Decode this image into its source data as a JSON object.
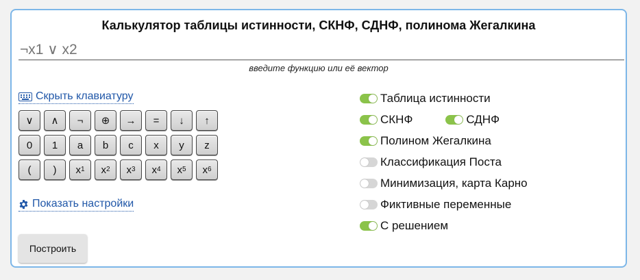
{
  "title": "Калькулятор таблицы истинности, СКНФ, СДНФ, полинома Жегалкина",
  "function_input": {
    "value": "",
    "placeholder": "¬x1 ∨ x2"
  },
  "hint": "введите функцию или её вектор",
  "keyboard_toggle": {
    "label": "Скрыть клавиатуру",
    "icon": "keyboard-icon"
  },
  "settings_toggle": {
    "label": "Показать настройки",
    "icon": "gear-icon"
  },
  "keyboard": {
    "row1": [
      "∨",
      "∧",
      "¬",
      "⊕",
      "→",
      "=",
      "↓",
      "↑"
    ],
    "row2": [
      "0",
      "1",
      "a",
      "b",
      "c",
      "x",
      "y",
      "z"
    ],
    "row3": [
      "(",
      ")"
    ],
    "vars": [
      {
        "base": "x",
        "sub": "1"
      },
      {
        "base": "x",
        "sub": "2"
      },
      {
        "base": "x",
        "sub": "3"
      },
      {
        "base": "x",
        "sub": "4"
      },
      {
        "base": "x",
        "sub": "5"
      },
      {
        "base": "x",
        "sub": "6"
      }
    ]
  },
  "build_button": "Построить",
  "options": {
    "truth_table": {
      "label": "Таблица истинности",
      "on": true
    },
    "cnf": {
      "label": "СКНФ",
      "on": true
    },
    "dnf": {
      "label": "СДНФ",
      "on": true
    },
    "zhegalkin": {
      "label": "Полином Жегалкина",
      "on": true
    },
    "post": {
      "label": "Классификация Поста",
      "on": false
    },
    "karnaugh": {
      "label": "Минимизация, карта Карно",
      "on": false
    },
    "fictitious": {
      "label": "Фиктивные переменные",
      "on": false
    },
    "solution": {
      "label": "С решением",
      "on": true
    }
  },
  "colors": {
    "accent": "#7cb6e8",
    "link": "#2057a8",
    "toggle_on": "#8bc34a",
    "toggle_off": "#d6d6d6"
  }
}
